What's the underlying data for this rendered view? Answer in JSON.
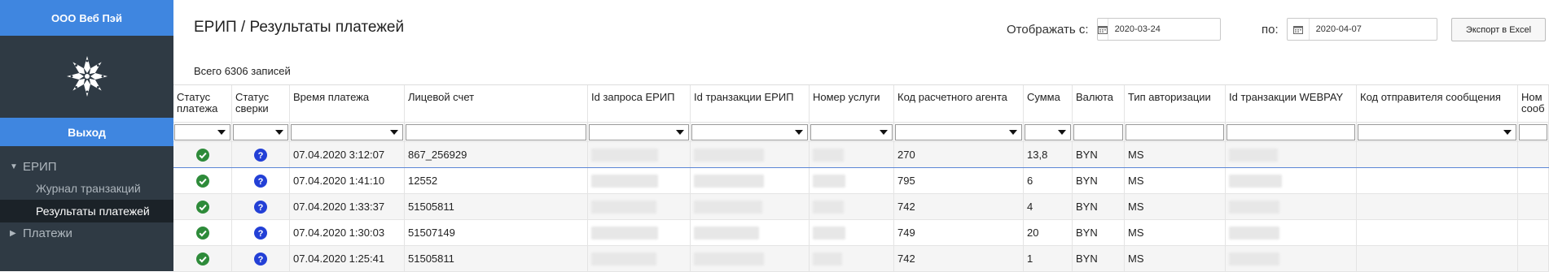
{
  "sidebar": {
    "brand_prefix": "ООО",
    "brand_name": "Веб Пэй",
    "logout_label": "Выход",
    "groups": [
      {
        "label": "ЕРИП",
        "items": [
          "Журнал транзакций",
          "Результаты платежей"
        ]
      },
      {
        "label": "Платежи"
      }
    ]
  },
  "header": {
    "title": "ЕРИП / Результаты платежей",
    "from_label": "Отображать с:",
    "from_value": "2020-03-24",
    "to_label": "по:",
    "to_value": "2020-04-07",
    "export_label": "Экспорт в Excel",
    "records_label": "Всего 6306 записей"
  },
  "table": {
    "columns": [
      "Статус платежа",
      "Статус сверки",
      "Время платежа",
      "Лицевой счет",
      "Id запроса ЕРИП",
      "Id транзакции ЕРИП",
      "Номер услуги",
      "Код расчетного агента",
      "Сумма",
      "Валюта",
      "Тип авторизации",
      "Id транзакции WEBPAY",
      "Код отправителя сообщения",
      "Ном сооб"
    ],
    "rows": [
      {
        "status": "ok",
        "reconcile": "unknown",
        "time": "07.04.2020 3:12:07",
        "account": "867_256929",
        "agent": "270",
        "sum": "13,8",
        "currency": "BYN",
        "auth": "MS"
      },
      {
        "status": "ok",
        "reconcile": "unknown",
        "time": "07.04.2020 1:41:10",
        "account": "12552",
        "agent": "795",
        "sum": "6",
        "currency": "BYN",
        "auth": "MS"
      },
      {
        "status": "ok",
        "reconcile": "unknown",
        "time": "07.04.2020 1:33:37",
        "account": "51505811",
        "agent": "742",
        "sum": "4",
        "currency": "BYN",
        "auth": "MS"
      },
      {
        "status": "ok",
        "reconcile": "unknown",
        "time": "07.04.2020 1:30:03",
        "account": "51507149",
        "agent": "749",
        "sum": "20",
        "currency": "BYN",
        "auth": "MS"
      },
      {
        "status": "ok",
        "reconcile": "unknown",
        "time": "07.04.2020 1:25:41",
        "account": "51505811",
        "agent": "742",
        "sum": "1",
        "currency": "BYN",
        "auth": "MS"
      }
    ]
  },
  "colors": {
    "accent": "#3f86e0",
    "sidebar": "#2f3a44",
    "status_ok": "#2e8b3a",
    "status_unknown": "#2340d6"
  }
}
